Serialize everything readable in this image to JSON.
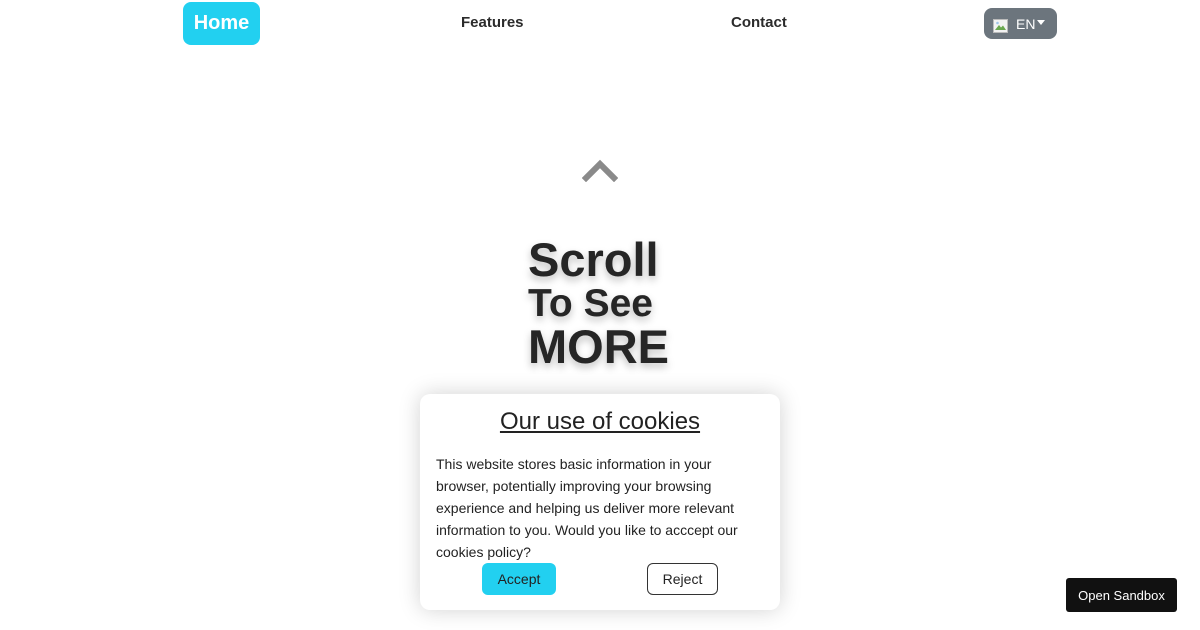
{
  "nav": {
    "home_label": "Home",
    "features_label": "Features",
    "contact_label": "Contact",
    "language": {
      "label": "EN",
      "icon": "flag-icon"
    }
  },
  "hero": {
    "scroll_icon": "chevron-up-icon",
    "line1": "Scroll",
    "line2": "To See",
    "line3": "MORE"
  },
  "cookie_banner": {
    "title": "Our use of cookies",
    "text": "This website stores basic information in your browser, potentially improving your browsing experience and helping us deliver more relevant information to you. Would you like to acccept our cookies policy?",
    "accept_label": "Accept",
    "reject_label": "Reject"
  },
  "sandbox_button_label": "Open Sandbox",
  "colors": {
    "accent": "#22d0f0",
    "lang_button": "#6c757d",
    "sandbox_button": "#111111"
  }
}
